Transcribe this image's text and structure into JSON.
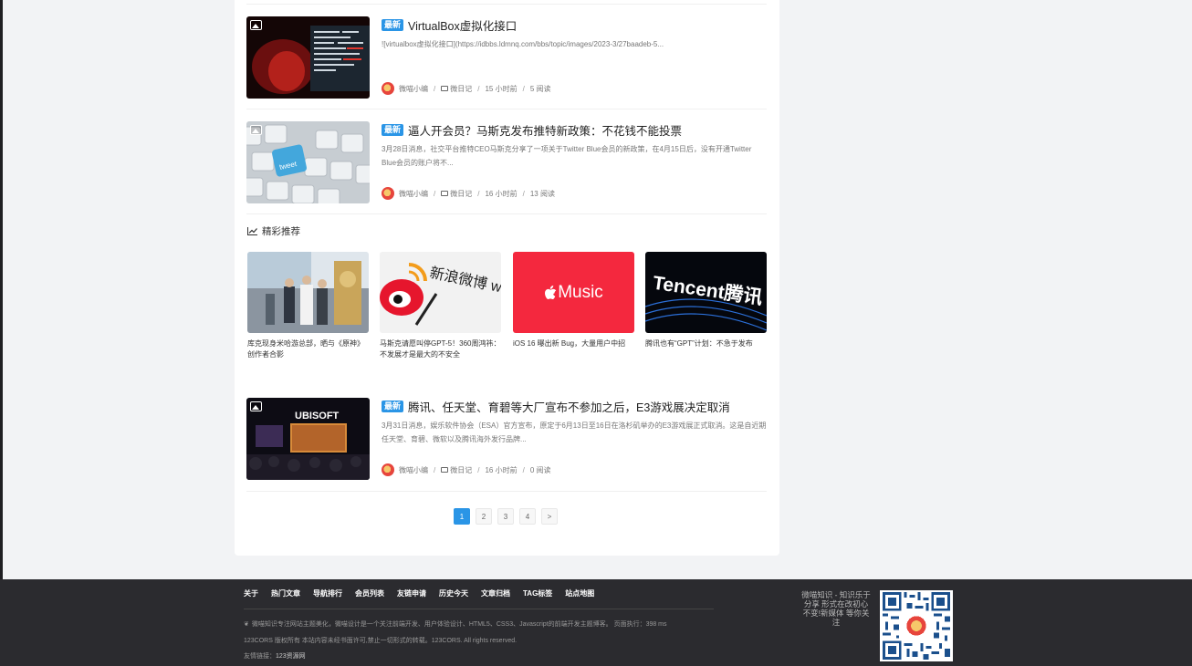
{
  "posts": [
    {
      "badge": "最新",
      "title": "VirtualBox虚拟化接口",
      "excerpt": "![virtualbox虚拟化接口](https://idbbs.ldmnq.com/bbs/topic/images/2023-3/27baadeb-5...",
      "author": "微喵小编",
      "category": "微日记",
      "time": "15 小时前",
      "reads": "5 阅读"
    },
    {
      "badge": "最新",
      "title": "逼人开会员？马斯克发布推特新政策：不花钱不能投票",
      "excerpt": "3月28日消息，社交平台推特CEO马斯克分享了一项关于Twitter Blue会员的新政策，在4月15日后，没有开通Twitter Blue会员的账户将不...",
      "author": "微喵小编",
      "category": "微日记",
      "time": "16 小时前",
      "reads": "13 阅读"
    },
    {
      "badge": "最新",
      "title": "腾讯、任天堂、育碧等大厂宣布不参加之后，E3游戏展决定取消",
      "excerpt": "3月31日消息，娱乐软件协会（ESA）官方宣布，原定于6月13日至16日在洛杉矶举办的E3游戏展正式取消。这是自近期任天堂、育碧、微软以及腾讯海外发行品牌...",
      "author": "微喵小编",
      "category": "微日记",
      "time": "16 小时前",
      "reads": "0 阅读"
    }
  ],
  "thumb_texts": {
    "tweet_key": "tweet",
    "ubisoft": "UBISOFT"
  },
  "section": {
    "title": "精彩推荐"
  },
  "recs": [
    {
      "title": "库克现身米哈游总部，晒与《原神》创作者合影",
      "img_text": ""
    },
    {
      "title": "马斯克请愿叫停GPT-5！360周鸿祎：不发展才是最大的不安全",
      "img_text": "新浪微博 weibo.com"
    },
    {
      "title": "iOS 16 曝出新 Bug，大量用户中招",
      "img_text": "Music"
    },
    {
      "title": "腾讯也有“GPT”计划：不急于发布",
      "img_text": "Tencent腾讯"
    }
  ],
  "pagination": {
    "pages": [
      "1",
      "2",
      "3",
      "4"
    ],
    "next": ">",
    "current": "1"
  },
  "footer": {
    "nav": [
      "关于",
      "热门文章",
      "导航排行",
      "会员列表",
      "友链申请",
      "历史今天",
      "文章归档",
      "TAG标签",
      "站点地图"
    ],
    "desc": "微喵知识专注网站主题美化，微喵设计是一个关注前端开发、用户体验设计、HTML5、CSS3、Javascript的前端开发主题博客。 页面执行：398 ms",
    "copyright": "123CORS 版权所有 本站内容未经书面许可,禁止一切形式的转载。123CORS. All rights reserved.",
    "links_label": "友情链接：",
    "links_value": "123资源网",
    "slogan": "微喵知识 - 知识乐于分享 形式在改初心不变!新媒体 等你关注"
  },
  "colors": {
    "accent": "#2a95e6",
    "footer_bg": "#2b2b2f",
    "apple_red": "#f4283e"
  }
}
